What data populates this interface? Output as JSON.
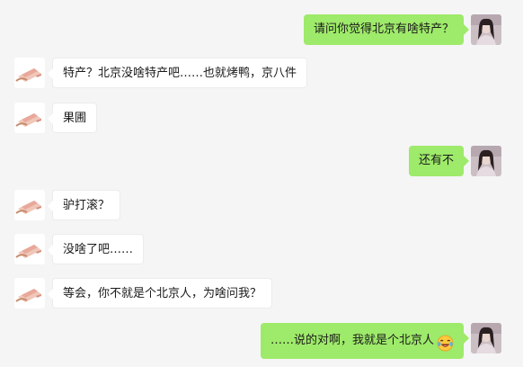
{
  "conversation": {
    "messages": [
      {
        "side": "right",
        "text": "请问你觉得北京有啥特产？"
      },
      {
        "side": "left",
        "text": "特产？北京没啥特产吧……也就烤鸭，京八件"
      },
      {
        "side": "left",
        "text": "果圃"
      },
      {
        "side": "right",
        "text": "还有不"
      },
      {
        "side": "left",
        "text": "驴打滚？"
      },
      {
        "side": "left",
        "text": "没啥了吧……"
      },
      {
        "side": "left",
        "text": "等会，你不就是个北京人，为啥问我？"
      },
      {
        "side": "right",
        "text": "……说的对啊，我就是个北京人",
        "emoji": "laughing-tears-emoji"
      }
    ]
  },
  "theme": {
    "background": "#f5f5f5",
    "sent_bubble": "#9eea6a",
    "received_bubble": "#ffffff"
  }
}
